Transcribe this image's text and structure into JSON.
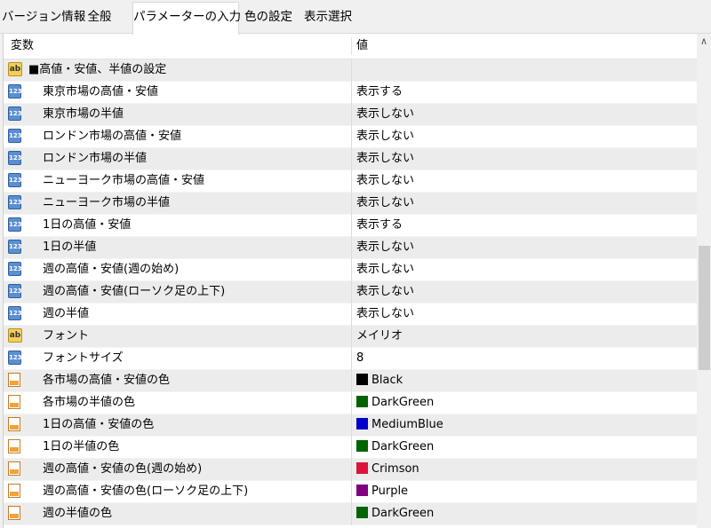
{
  "tabs": [
    {
      "label": "バージョン情報"
    },
    {
      "label": "全般"
    },
    {
      "label": "パラメーターの入力"
    },
    {
      "label": "色の設定"
    },
    {
      "label": "表示選択"
    }
  ],
  "grid": {
    "header": {
      "variable": "変数",
      "value": "値"
    },
    "rows": [
      {
        "icon": "ab",
        "label": "■高値・安値、半値の設定",
        "value": "",
        "indent": false
      },
      {
        "icon": "123",
        "label": "東京市場の高値・安値",
        "value": "表示する",
        "indent": true
      },
      {
        "icon": "123",
        "label": "東京市場の半値",
        "value": "表示しない",
        "indent": true
      },
      {
        "icon": "123",
        "label": "ロンドン市場の高値・安値",
        "value": "表示しない",
        "indent": true
      },
      {
        "icon": "123",
        "label": "ロンドン市場の半値",
        "value": "表示しない",
        "indent": true
      },
      {
        "icon": "123",
        "label": "ニューヨーク市場の高値・安値",
        "value": "表示しない",
        "indent": true
      },
      {
        "icon": "123",
        "label": "ニューヨーク市場の半値",
        "value": "表示しない",
        "indent": true
      },
      {
        "icon": "123",
        "label": "1日の高値・安値",
        "value": "表示する",
        "indent": true
      },
      {
        "icon": "123",
        "label": "1日の半値",
        "value": "表示しない",
        "indent": true
      },
      {
        "icon": "123",
        "label": "週の高値・安値(週の始め)",
        "value": "表示しない",
        "indent": true
      },
      {
        "icon": "123",
        "label": "週の高値・安値(ローソク足の上下)",
        "value": "表示しない",
        "indent": true
      },
      {
        "icon": "123",
        "label": "週の半値",
        "value": "表示しない",
        "indent": true
      },
      {
        "icon": "ab",
        "label": "フォント",
        "value": "メイリオ",
        "indent": true
      },
      {
        "icon": "123",
        "label": "フォントサイズ",
        "value": "8",
        "indent": true
      },
      {
        "icon": "color",
        "label": "各市場の高値・安値の色",
        "value": "Black",
        "color": "#000000",
        "indent": true
      },
      {
        "icon": "color",
        "label": "各市場の半値の色",
        "value": "DarkGreen",
        "color": "#006400",
        "indent": true
      },
      {
        "icon": "color",
        "label": "1日の高値・安値の色",
        "value": "MediumBlue",
        "color": "#0000CD",
        "indent": true
      },
      {
        "icon": "color",
        "label": "1日の半値の色",
        "value": "DarkGreen",
        "color": "#006400",
        "indent": true
      },
      {
        "icon": "color",
        "label": "週の高値・安値の色(週の始め)",
        "value": "Crimson",
        "color": "#DC143C",
        "indent": true
      },
      {
        "icon": "color",
        "label": "週の高値・安値の色(ローソク足の上下)",
        "value": "Purple",
        "color": "#800080",
        "indent": true
      },
      {
        "icon": "color",
        "label": "週の半値の色",
        "value": "DarkGreen",
        "color": "#006400",
        "indent": true
      }
    ]
  }
}
